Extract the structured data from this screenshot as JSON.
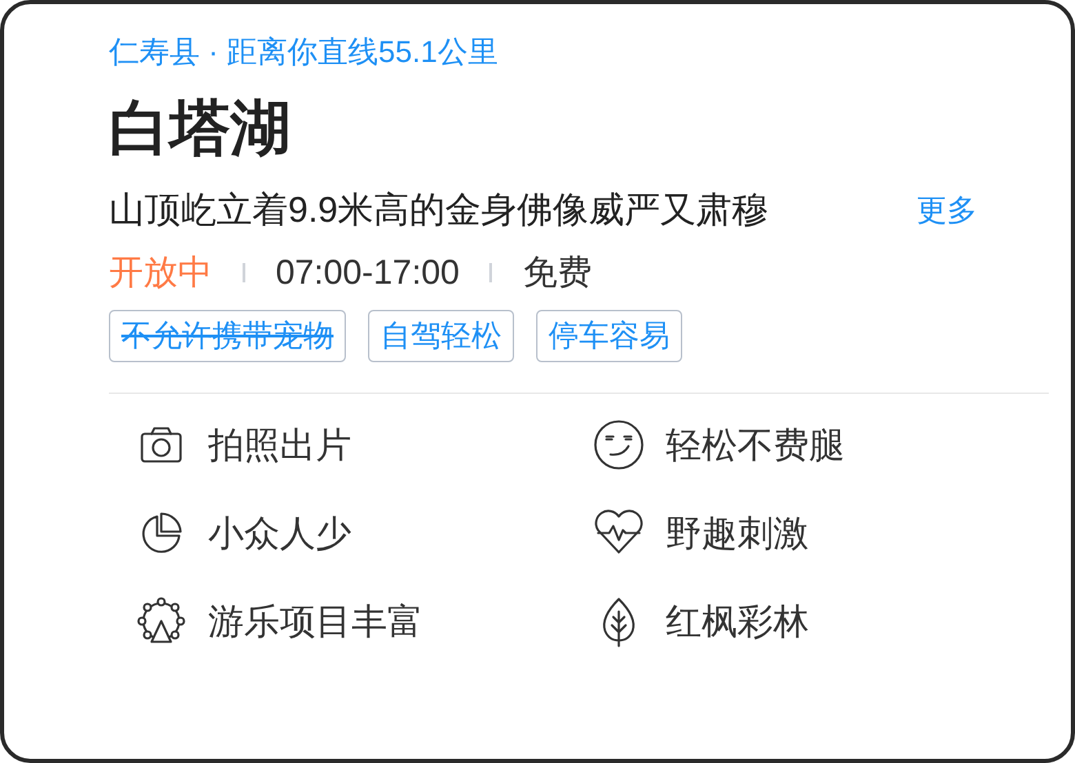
{
  "location": "仁寿县 · 距离你直线55.1公里",
  "title": "白塔湖",
  "description": "山顶屹立着9.9米高的金身佛像威严又肃穆",
  "more_link": "更多",
  "status": {
    "text": "开放中",
    "open": true
  },
  "hours": "07:00-17:00",
  "price": "免费",
  "tags": [
    {
      "label": "不允许携带宠物",
      "struck": true
    },
    {
      "label": "自驾轻松",
      "struck": false
    },
    {
      "label": "停车容易",
      "struck": false
    }
  ],
  "features": [
    {
      "kind": "camera",
      "label": "拍照出片"
    },
    {
      "kind": "smile",
      "label": "轻松不费腿"
    },
    {
      "kind": "pie",
      "label": "小众人少"
    },
    {
      "kind": "heartbeat",
      "label": "野趣刺激"
    },
    {
      "kind": "ferris",
      "label": "游乐项目丰富"
    },
    {
      "kind": "leaf",
      "label": "红枫彩林"
    }
  ]
}
